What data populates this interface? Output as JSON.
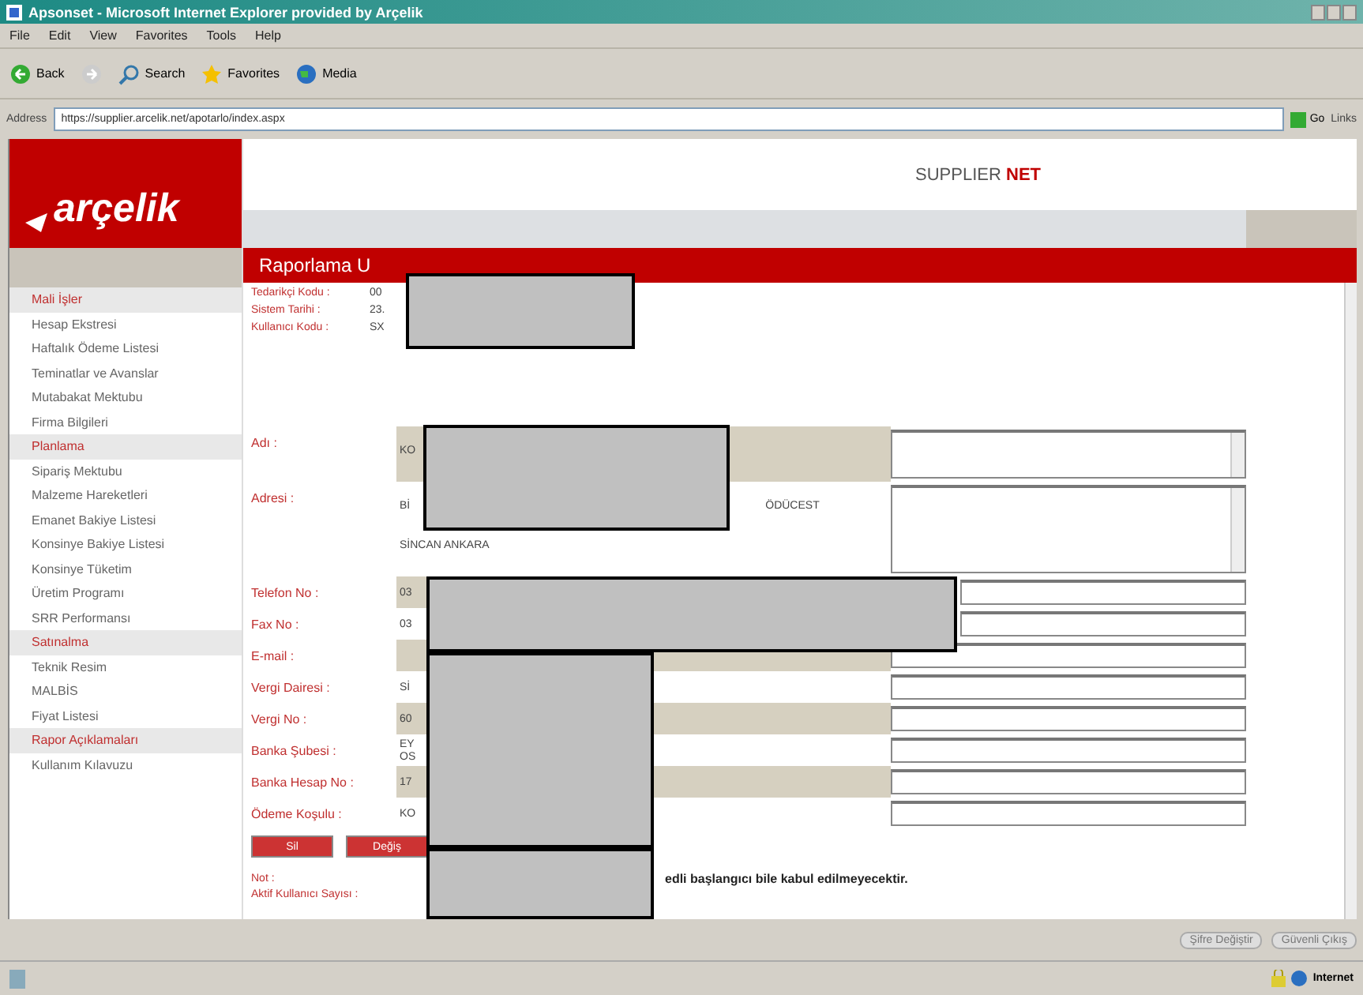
{
  "window": {
    "title": "Apsonset - Microsoft Internet Explorer provided by Arçelik"
  },
  "menu": [
    "File",
    "Edit",
    "View",
    "Favorites",
    "Tools",
    "Help"
  ],
  "toolbar": [
    {
      "kind": "back",
      "label": "Back"
    },
    {
      "kind": "forward"
    },
    {
      "kind": "search",
      "label": "Search"
    },
    {
      "kind": "favorites",
      "label": "Favorites"
    },
    {
      "kind": "media",
      "label": "Media"
    }
  ],
  "address": {
    "label": "Address",
    "value": "https://supplier.arcelik.net/apotarlo/index.aspx",
    "go": "Go",
    "links": "Links"
  },
  "logo": "arçelik",
  "brand": {
    "plain": "SUPPLIER ",
    "accent": "NET"
  },
  "sidebar": [
    {
      "kind": "section",
      "label": "Mali İşler"
    },
    {
      "kind": "item",
      "label": "Hesap Ekstresi"
    },
    {
      "kind": "item",
      "label": "Haftalık Ödeme Listesi"
    },
    {
      "kind": "item",
      "label": "Teminatlar ve Avanslar"
    },
    {
      "kind": "item",
      "label": "Mutabakat Mektubu"
    },
    {
      "kind": "item",
      "label": "Firma Bilgileri"
    },
    {
      "kind": "section",
      "label": "Planlama"
    },
    {
      "kind": "item",
      "label": "Sipariş Mektubu"
    },
    {
      "kind": "item",
      "label": "Malzeme Hareketleri"
    },
    {
      "kind": "item",
      "label": "Emanet Bakiye Listesi"
    },
    {
      "kind": "item",
      "label": "Konsinye Bakiye Listesi"
    },
    {
      "kind": "item",
      "label": "Konsinye Tüketim"
    },
    {
      "kind": "item",
      "label": "Üretim Programı"
    },
    {
      "kind": "item",
      "label": "SRR Performansı"
    },
    {
      "kind": "section",
      "label": "Satınalma"
    },
    {
      "kind": "item",
      "label": "Teknik Resim"
    },
    {
      "kind": "item",
      "label": "MALBİS"
    },
    {
      "kind": "item",
      "label": "Fiyat Listesi"
    },
    {
      "kind": "section",
      "label": "Rapor Açıklamaları"
    },
    {
      "kind": "item",
      "label": "Kullanım Kılavuzu"
    }
  ],
  "panel_title": "Raporlama U",
  "info": [
    {
      "label": "Tedarikçi Kodu :",
      "value": "00"
    },
    {
      "label": "Sistem Tarihi :",
      "value": "23."
    },
    {
      "label": "Kullanıcı Kodu :",
      "value": "SX"
    }
  ],
  "fields": [
    {
      "kind": "multiline",
      "label": "Adı :",
      "value": "KO"
    },
    {
      "kind": "multiline",
      "label": "Adresi :",
      "value": "Bİ",
      "value_end": "ÖDÜCEST",
      "value_2": "SİNCAN ANKARA"
    },
    {
      "kind": "single",
      "label": "Telefon No :",
      "value": "03"
    },
    {
      "kind": "single",
      "label": "Fax No :",
      "value": "03"
    },
    {
      "kind": "single",
      "label": "E-mail :"
    },
    {
      "kind": "single",
      "label": "Vergi Dairesi :",
      "value": "Sİ"
    },
    {
      "kind": "single",
      "label": "Vergi No :",
      "value": "60"
    },
    {
      "kind": "single",
      "label": "Banka Şubesi :",
      "value": "EY",
      "value_2": "OS"
    },
    {
      "kind": "single",
      "label": "Banka Hesap No :",
      "value": "17"
    },
    {
      "kind": "single",
      "label": "Ödeme Koşulu :",
      "value": "KO"
    }
  ],
  "actions": [
    "Sil",
    "Değiş"
  ],
  "note": {
    "label": "Not :",
    "text": "edli başlangıcı bile kabul edilmeyecektir."
  },
  "active_users": "Aktif Kullanıcı Sayısı :",
  "footer_buttons": [
    "Şifre Değiştir",
    "Güvenli Çıkış"
  ],
  "status": {
    "zone": "Internet"
  }
}
